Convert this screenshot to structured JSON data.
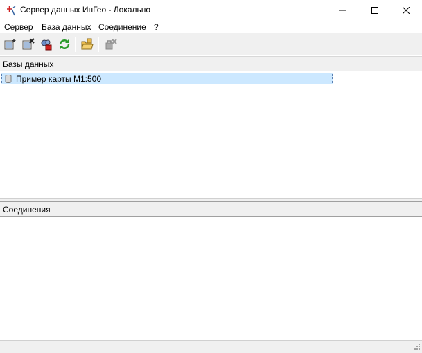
{
  "window": {
    "title": "Сервер данных ИнГео - Локально",
    "icon": "ingeo-server-icon",
    "controls": [
      "minimize",
      "maximize",
      "close"
    ]
  },
  "menu": {
    "items": [
      "Сервер",
      "База данных",
      "Соединение",
      "?"
    ]
  },
  "toolbar": {
    "buttons": [
      "add-database-icon",
      "remove-database-icon",
      "database-settings-icon",
      "refresh-icon",
      "open-folder-icon",
      "disconnect-icon"
    ]
  },
  "databases_panel": {
    "header": "Базы данных",
    "items": [
      {
        "label": "Пример карты М1:500",
        "icon": "database-icon",
        "selected": true
      }
    ]
  },
  "connections_panel": {
    "header": "Соединения",
    "items": []
  },
  "colors": {
    "selection": "#cce8ff",
    "panel_bg": "#f0f0f0"
  }
}
